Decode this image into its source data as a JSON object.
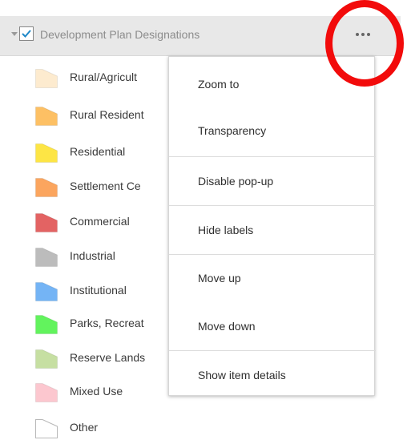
{
  "layer": {
    "title": "Development Plan Designations",
    "checked": true,
    "expand_icon": "caret-down-icon",
    "more_icon": "ellipsis-icon"
  },
  "legend": [
    {
      "label": "Rural/Agricult",
      "color": "#fdebcf"
    },
    {
      "label": "Rural Resident",
      "color": "#fdc064"
    },
    {
      "label": "Residential",
      "color": "#fde545"
    },
    {
      "label": "Settlement Ce",
      "color": "#fba55e"
    },
    {
      "label": "Commercial",
      "color": "#e36363"
    },
    {
      "label": "Industrial",
      "color": "#bcbcbc"
    },
    {
      "label": "Institutional",
      "color": "#74b4f5"
    },
    {
      "label": "Parks, Recreat",
      "color": "#62f35d"
    },
    {
      "label": "Reserve Lands",
      "color": "#c6dfa2"
    },
    {
      "label": "Mixed Use",
      "color": "#fcc7cf"
    },
    {
      "label": "Other",
      "color": "#ffffff"
    }
  ],
  "menu": {
    "groups": [
      [
        "Zoom to",
        "Transparency"
      ],
      [
        "Disable pop-up"
      ],
      [
        "Hide labels"
      ],
      [
        "Move up",
        "Move down"
      ],
      [
        "Show item details"
      ]
    ]
  },
  "colors": {
    "header_bg": "#e8e8e8",
    "checkbox_check": "#1e88c8",
    "annotation_circle": "#f20b0b"
  }
}
